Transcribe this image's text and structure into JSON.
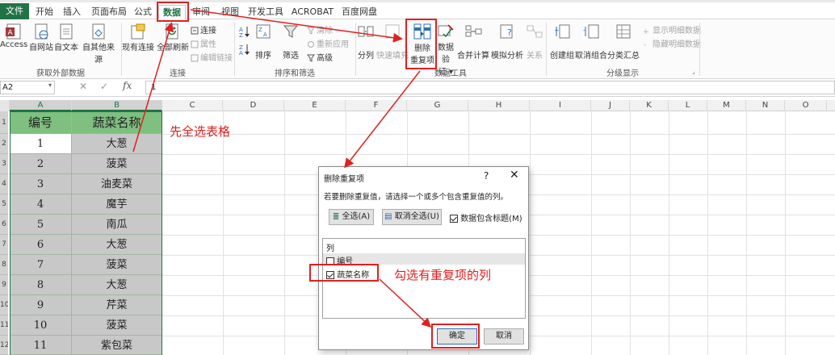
{
  "tabs": {
    "file": "文件",
    "items": [
      "开始",
      "插入",
      "页面布局",
      "公式",
      "数据",
      "审阅",
      "视图",
      "开发工具",
      "ACROBAT",
      "百度网盘"
    ],
    "active": "数据"
  },
  "ribbon": {
    "ext_data": {
      "access": "Access",
      "web": "自网站",
      "text": "自文本",
      "other": "自其他来源",
      "label": "获取外部数据"
    },
    "connections": {
      "existing": "现有连接",
      "refresh_all": "全部刷新",
      "conn": "连接",
      "props": "属性",
      "edit_links": "编辑链接",
      "label": "连接"
    },
    "sort_filter": {
      "sort": "排序",
      "filter": "筛选",
      "clear": "清除",
      "reapply": "重新应用",
      "advanced": "高级",
      "label": "排序和筛选"
    },
    "data_tools": {
      "split": "分列",
      "flash_fill": "快速填充",
      "remove_dup_1": "删除",
      "remove_dup_2": "重复项",
      "validation_1": "数据验",
      "validation_2": "证 ▾",
      "consolidate": "合并计算",
      "what_if": "模拟分析",
      "relations": "关系",
      "label": "数据工具"
    },
    "outline": {
      "group": "创建组",
      "ungroup": "取消组合",
      "subtotal": "分类汇总",
      "show": "显示明细数据",
      "hide": "隐藏明细数据",
      "label": "分级显示"
    }
  },
  "formula_bar": {
    "name_box": "A2",
    "cancel": "✕",
    "confirm": "✓",
    "fx": "fx",
    "value": "1"
  },
  "columns": [
    "A",
    "B",
    "C",
    "D",
    "E",
    "F",
    "G",
    "H",
    "I",
    "J",
    "K",
    "L",
    "M",
    "N",
    "O"
  ],
  "rows": [
    "1",
    "2",
    "3",
    "4",
    "5",
    "6",
    "7",
    "8",
    "9",
    "10",
    "11",
    "12"
  ],
  "table": {
    "headers": [
      "编号",
      "蔬菜名称"
    ],
    "rows": [
      [
        "1",
        "大葱"
      ],
      [
        "2",
        "菠菜"
      ],
      [
        "3",
        "油麦菜"
      ],
      [
        "4",
        "魔芋"
      ],
      [
        "5",
        "南瓜"
      ],
      [
        "6",
        "大葱"
      ],
      [
        "7",
        "菠菜"
      ],
      [
        "8",
        "大葱"
      ],
      [
        "9",
        "芹菜"
      ],
      [
        "10",
        "菠菜"
      ],
      [
        "11",
        "紫包菜"
      ]
    ]
  },
  "dialog": {
    "title": "删除重复项",
    "help": "?",
    "close": "✕",
    "description": "若要删除重复值，请选择一个或多个包含重复值的列。",
    "select_all": "全选(A)",
    "unselect_all": "取消全选(U)",
    "has_headers": "数据包含标题(M)",
    "list_header": "列",
    "items": [
      {
        "label": "编号",
        "checked": false
      },
      {
        "label": "蔬菜名称",
        "checked": true
      }
    ],
    "ok": "确定",
    "cancel": "取消"
  },
  "annotations": {
    "step1": "先全选表格",
    "step2": "勾选有重复项的列"
  },
  "colors": {
    "excel_green": "#217346",
    "annotation_red": "#e02020",
    "selection_gray": "#c8c8c8",
    "header_green": "#7fbf7f"
  }
}
